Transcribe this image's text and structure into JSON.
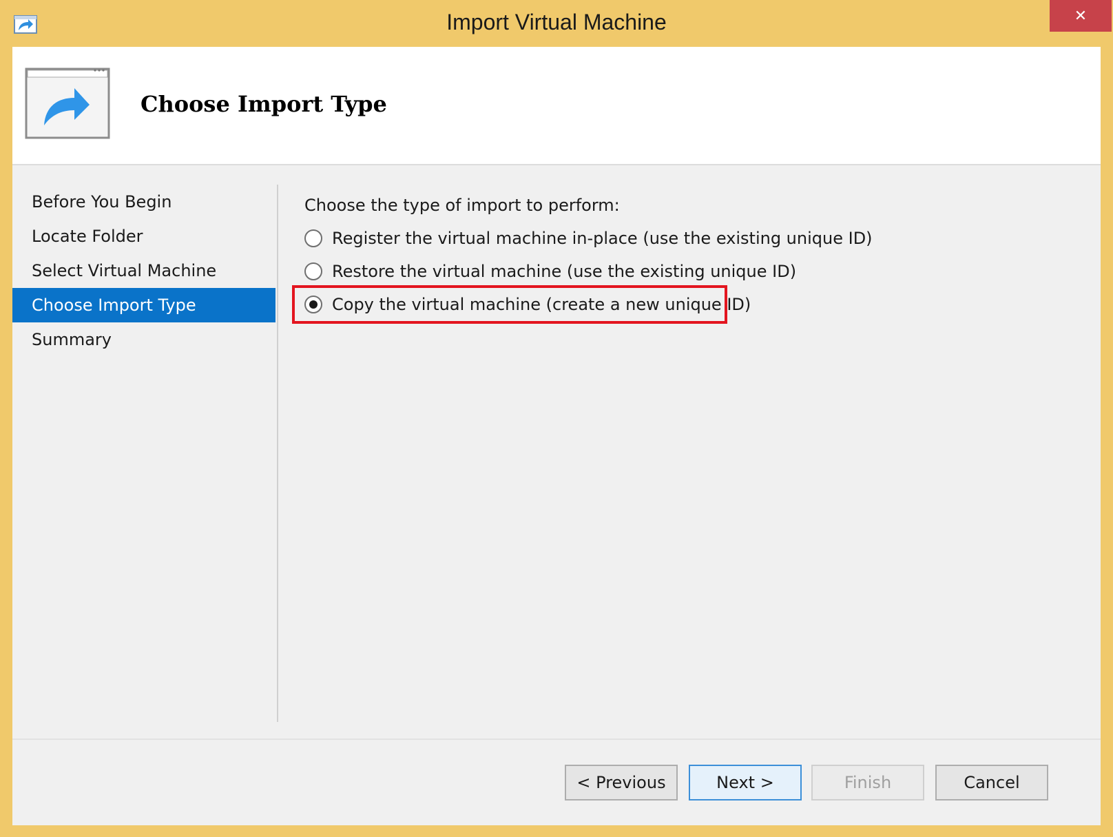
{
  "window": {
    "title": "Import Virtual Machine",
    "close_glyph": "✕",
    "app_icon": "import-arrow-icon"
  },
  "header": {
    "title": "Choose Import Type",
    "icon": "import-window-arrow-icon"
  },
  "nav": {
    "items": [
      {
        "label": "Before You Begin",
        "active": false
      },
      {
        "label": "Locate Folder",
        "active": false
      },
      {
        "label": "Select Virtual Machine",
        "active": false
      },
      {
        "label": "Choose Import Type",
        "active": true
      },
      {
        "label": "Summary",
        "active": false
      }
    ]
  },
  "content": {
    "prompt": "Choose the type of import to perform:",
    "options": [
      {
        "label": "Register the virtual machine in-place (use the existing unique ID)",
        "selected": false
      },
      {
        "label": "Restore the virtual machine (use the existing unique ID)",
        "selected": false
      },
      {
        "label": "Copy the virtual machine (create a new unique ID)",
        "selected": true
      }
    ]
  },
  "buttons": {
    "previous": "< Previous",
    "next": "Next >",
    "finish": "Finish",
    "cancel": "Cancel"
  },
  "colors": {
    "frame": "#f0c96b",
    "close": "#c7424a",
    "nav_active": "#0a73c9",
    "highlight": "#e3151f"
  }
}
